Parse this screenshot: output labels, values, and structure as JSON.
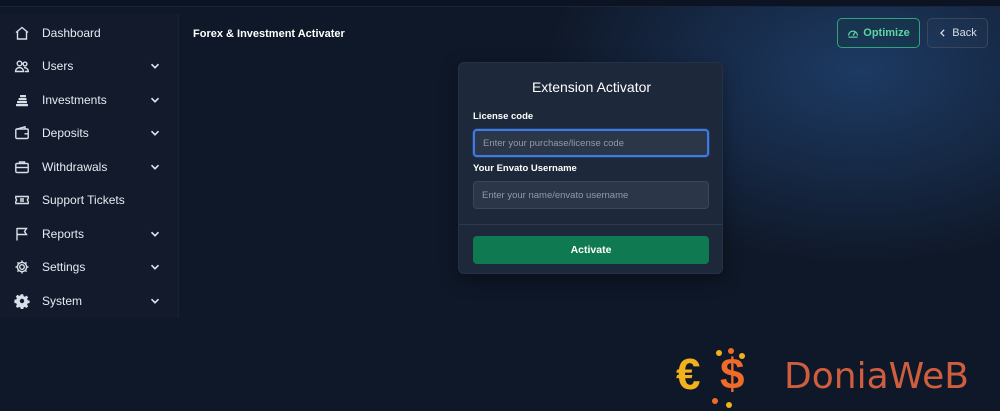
{
  "sidebar": {
    "items": [
      {
        "label": "Dashboard",
        "icon": "home-icon",
        "has_submenu": false
      },
      {
        "label": "Users",
        "icon": "users-icon",
        "has_submenu": true
      },
      {
        "label": "Investments",
        "icon": "coins-icon",
        "has_submenu": true
      },
      {
        "label": "Deposits",
        "icon": "wallet-icon",
        "has_submenu": true
      },
      {
        "label": "Withdrawals",
        "icon": "briefcase-icon",
        "has_submenu": true
      },
      {
        "label": "Support Tickets",
        "icon": "ticket-icon",
        "has_submenu": false
      },
      {
        "label": "Reports",
        "icon": "flag-icon",
        "has_submenu": true
      },
      {
        "label": "Settings",
        "icon": "gear-icon",
        "has_submenu": true
      },
      {
        "label": "System",
        "icon": "cog-icon",
        "has_submenu": true
      }
    ]
  },
  "header": {
    "title": "Forex & Investment Activater",
    "optimize_label": "Optimize",
    "back_label": "Back"
  },
  "card": {
    "title": "Extension Activator",
    "license_label": "License code",
    "license_placeholder": "Enter your purchase/license code",
    "license_value": "",
    "username_label": "Your Envato Username",
    "username_placeholder": "Enter your name/envato username",
    "username_value": "",
    "activate_label": "Activate"
  },
  "watermark": {
    "text": "DoniaWeB",
    "symbols": "€$"
  },
  "colors": {
    "background": "#0f1828",
    "sidebar": "#121a2b",
    "card": "#1d293a",
    "accent_green": "#0f7a52",
    "optimize_border": "#2fa67a",
    "focus_blue": "#3f7be6"
  }
}
